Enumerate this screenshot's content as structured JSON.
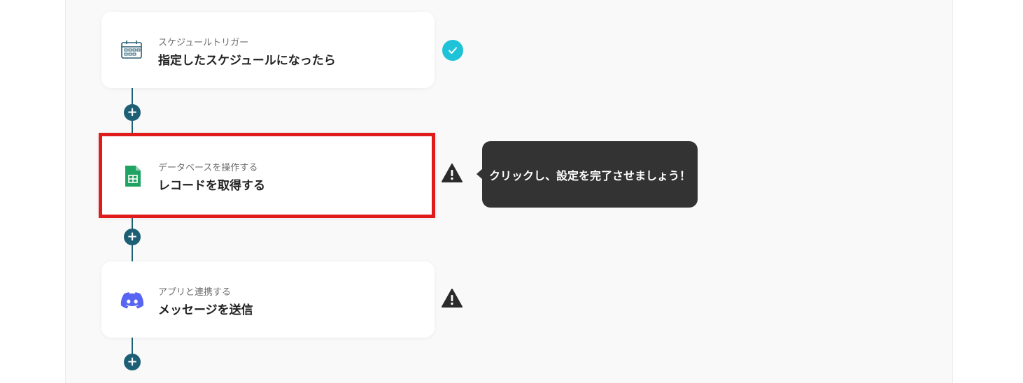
{
  "flow": {
    "steps": [
      {
        "icon": "calendar-schedule-icon",
        "subtitle": "スケジュールトリガー",
        "title": "指定したスケジュールになったら",
        "status": "complete"
      },
      {
        "icon": "google-sheets-icon",
        "subtitle": "データベースを操作する",
        "title": "レコードを取得する",
        "status": "warning",
        "highlighted": true
      },
      {
        "icon": "discord-icon",
        "subtitle": "アプリと連携する",
        "title": "メッセージを送信",
        "status": "warning"
      }
    ],
    "add_label": "+"
  },
  "tooltip": {
    "text": "クリックし、設定を完了させましょう！"
  },
  "colors": {
    "flow_line": "#1d5f75",
    "check": "#1ec3d7",
    "highlight": "#e01b1b",
    "tooltip_bg": "#333333",
    "sheets_green": "#1ea362",
    "discord": "#5865f2"
  }
}
